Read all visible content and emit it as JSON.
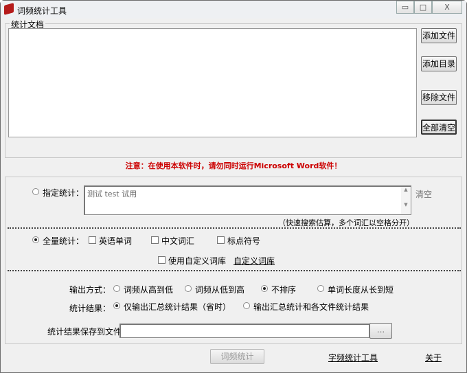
{
  "window": {
    "title": "词频统计工具",
    "minimize": "▭",
    "maximize": "□",
    "close": "X"
  },
  "documents": {
    "group_label": "统计文档",
    "add_file": "添加文件",
    "add_dir": "添加目录",
    "remove_file": "移除文件",
    "clear_all": "全部清空"
  },
  "warning": "注意：在使用本软件时，请勿同时运行Microsoft Word软件！",
  "specified": {
    "label": "指定统计：",
    "selected": false,
    "value": "测试 test 试用",
    "clear": "清空",
    "hint": "（快速搜索估算，多个词汇以空格分开）"
  },
  "full": {
    "label": "全量统计：",
    "selected": true,
    "checks": [
      {
        "label": "英语单词",
        "checked": false
      },
      {
        "label": "中文词汇",
        "checked": false
      },
      {
        "label": "标点符号",
        "checked": false
      }
    ],
    "use_custom": {
      "label": "使用自定义词库",
      "checked": false
    },
    "custom_link": "自定义词库"
  },
  "output": {
    "label": "输出方式：",
    "options": [
      {
        "label": "词频从高到低",
        "selected": false
      },
      {
        "label": "词频从低到高",
        "selected": false
      },
      {
        "label": "不排序",
        "selected": true
      },
      {
        "label": "单词长度从长到短",
        "selected": false
      }
    ]
  },
  "result": {
    "label": "统计结果：",
    "options": [
      {
        "label": "仅输出汇总统计结果（省时）",
        "selected": true
      },
      {
        "label": "输出汇总统计和各文件统计结果",
        "selected": false
      }
    ]
  },
  "save": {
    "label": "统计结果保存到文件：",
    "value": "",
    "browse": "..."
  },
  "footer": {
    "run": "词频统计",
    "char_tool": "字频统计工具",
    "about": "关于"
  },
  "colors": {
    "warning": "#cc0000"
  }
}
